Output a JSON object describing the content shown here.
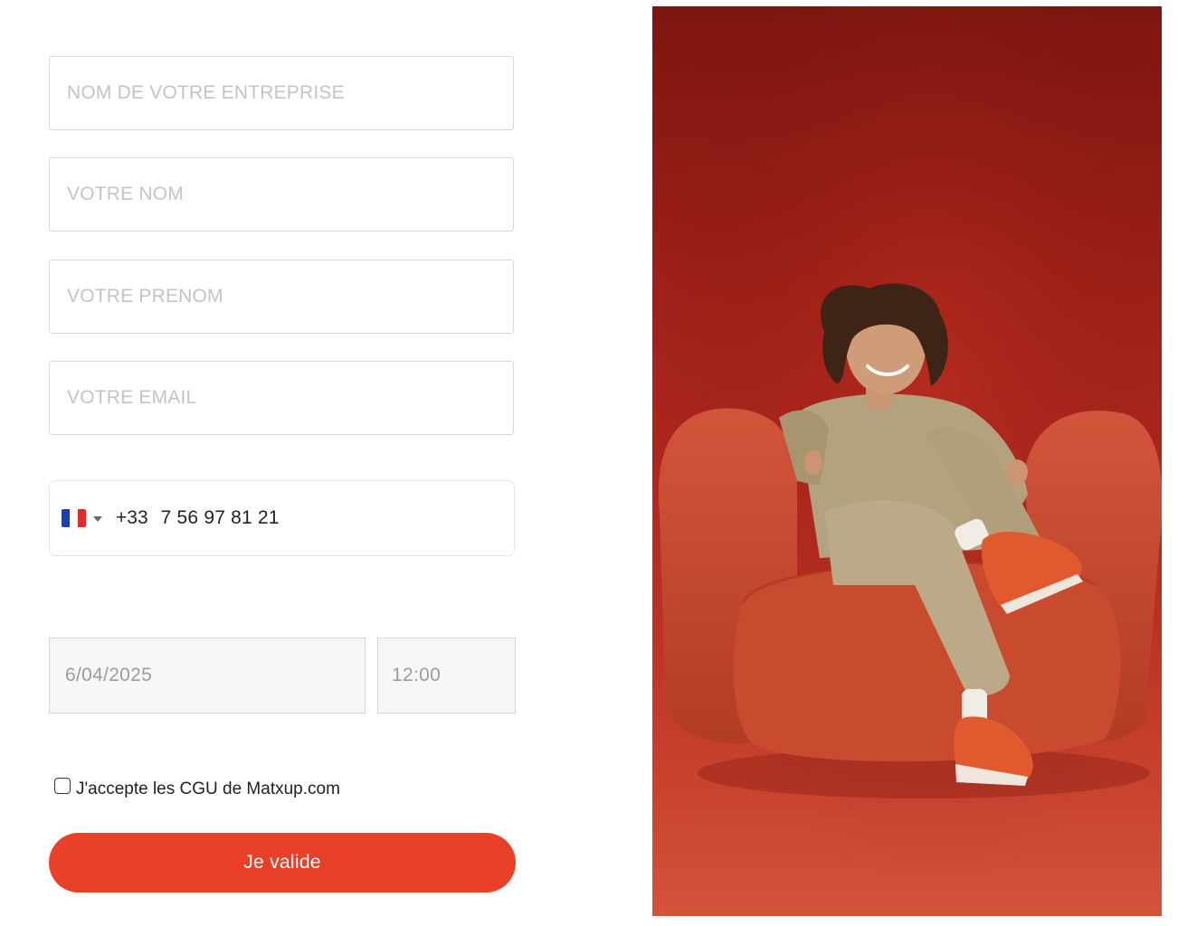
{
  "form": {
    "company": {
      "placeholder": "NOM DE VOTRE ENTREPRISE",
      "value": ""
    },
    "lastname": {
      "placeholder": "VOTRE NOM",
      "value": ""
    },
    "firstname": {
      "placeholder": "VOTRE PRENOM",
      "value": ""
    },
    "email": {
      "placeholder": "VOTRE EMAIL",
      "value": ""
    },
    "phone": {
      "country_icon": "france-flag-icon",
      "dial_code": "+33",
      "number": "7 56 97 81 21"
    },
    "date": "6/04/2025",
    "time": "12:00",
    "terms_label": "J'accepte les CGU de Matxup.com",
    "terms_checked": false,
    "submit_label": "Je valide"
  },
  "colors": {
    "accent": "#e84127",
    "photo_background": "#9b1f18",
    "armchair": "#c94a2c"
  },
  "hero_image": {
    "icon": "woman-in-armchair-photo"
  }
}
